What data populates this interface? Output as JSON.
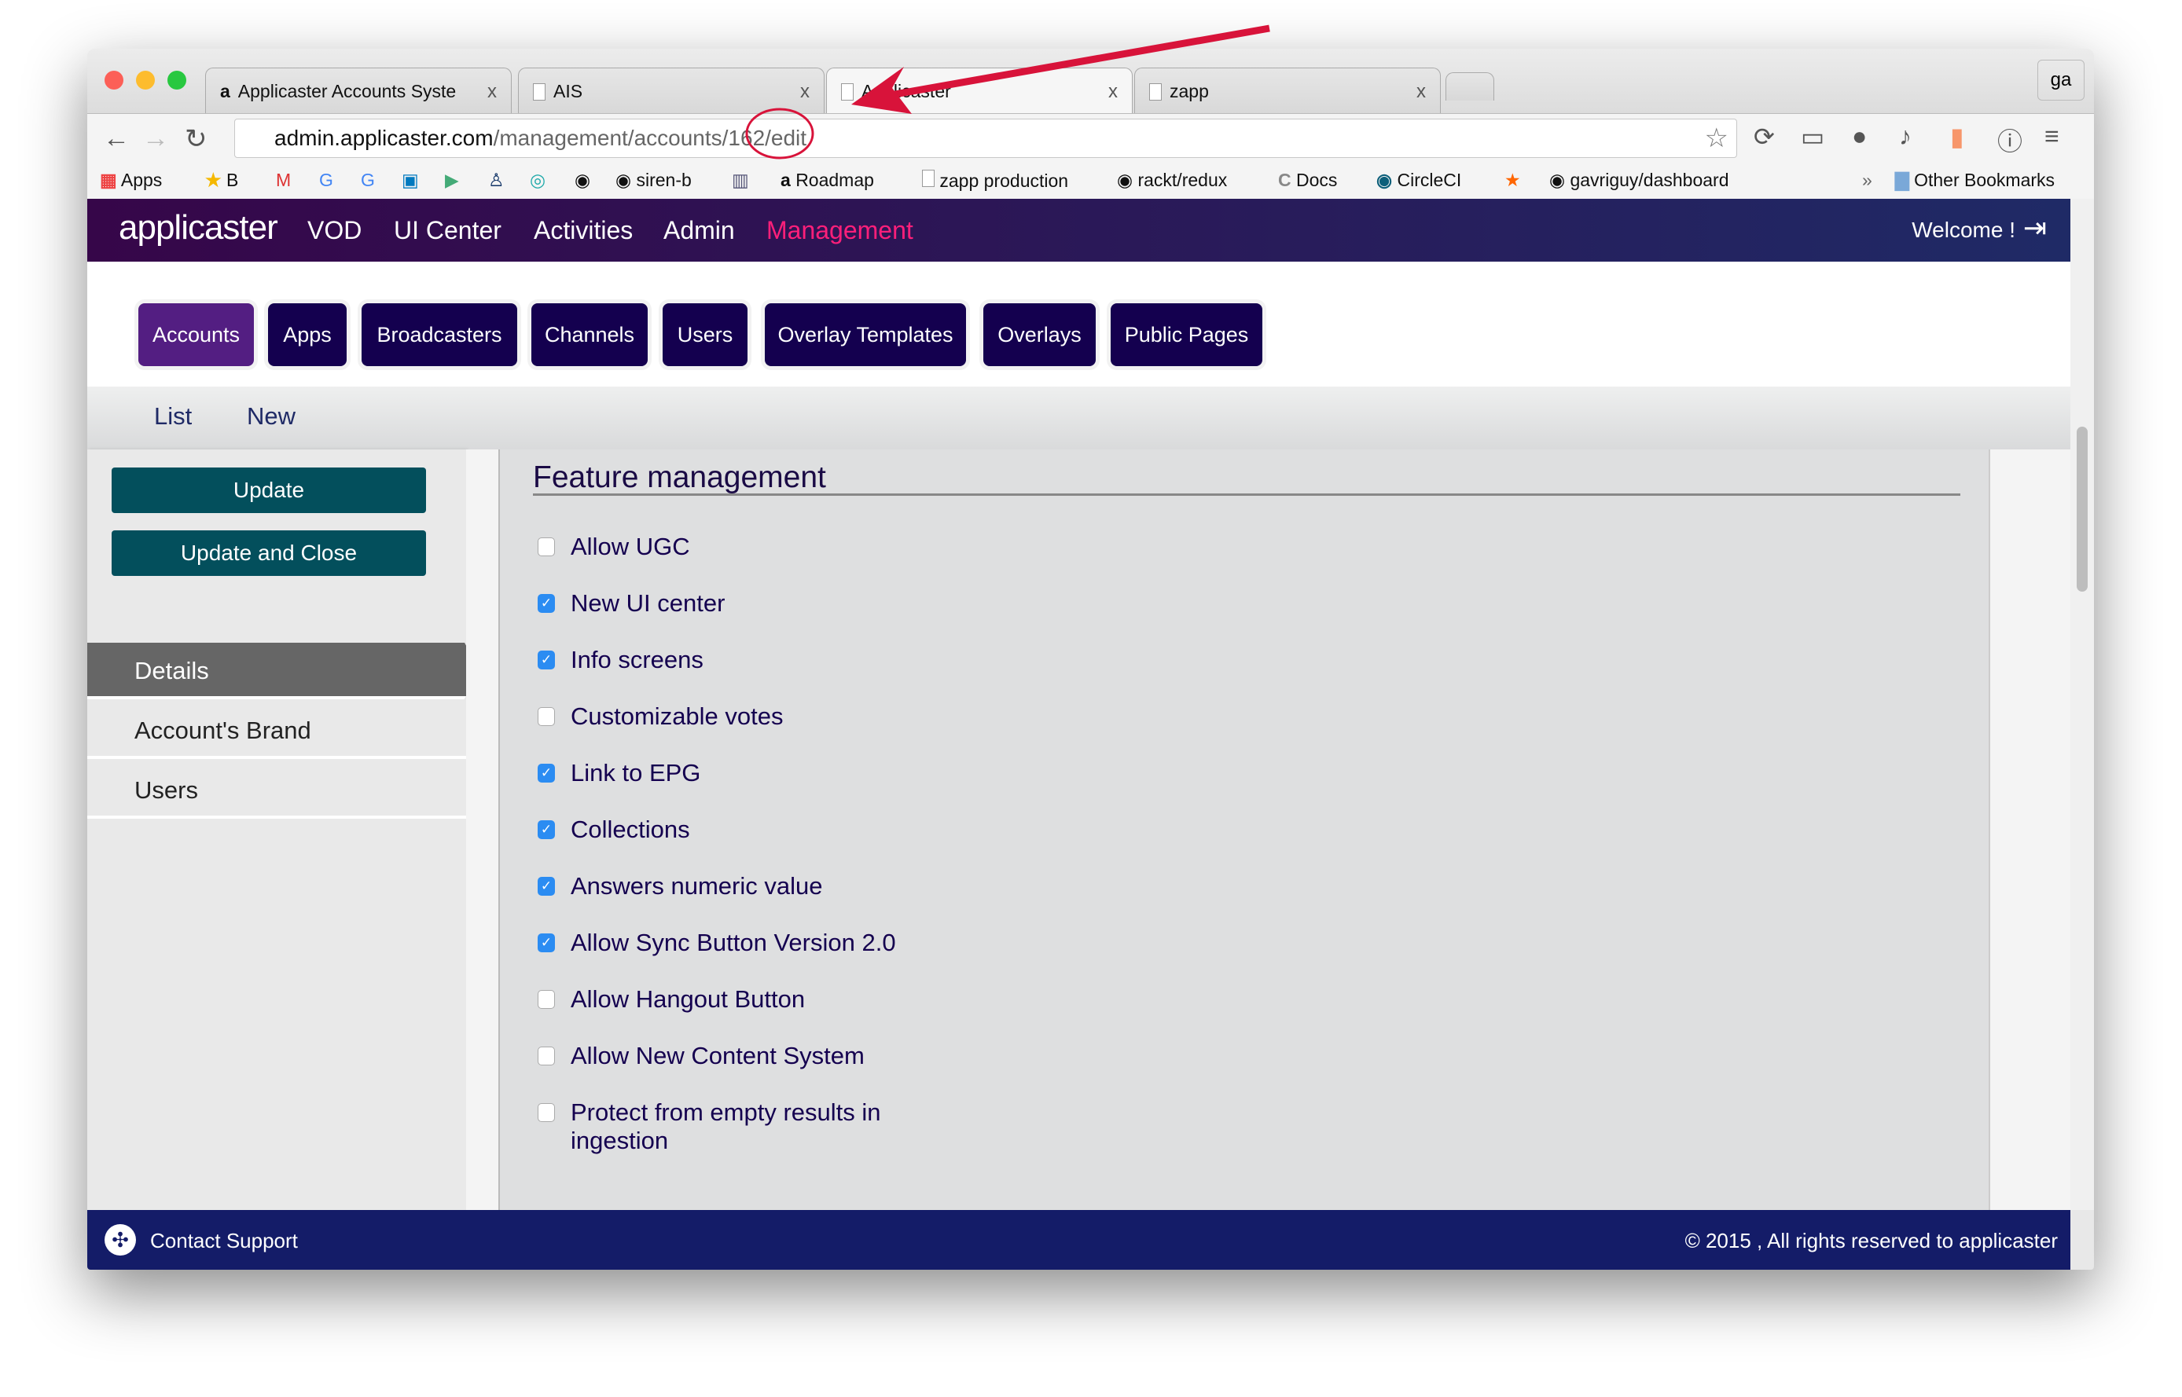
{
  "browser": {
    "tabs": [
      {
        "title": "Applicaster Accounts Syste",
        "icon": "applicaster-favicon"
      },
      {
        "title": "AIS",
        "icon": "page-icon"
      },
      {
        "title": "Applicaster",
        "icon": "page-icon"
      },
      {
        "title": "zapp",
        "icon": "page-icon"
      }
    ],
    "close_glyph": "x",
    "profile": "ga",
    "url_host": "admin.applicaster.com",
    "url_path": "/management/accounts/162/edit",
    "bookmarks": [
      "Apps",
      "B",
      "siren-b",
      "Roadmap",
      "zapp production",
      "rackt/redux",
      "Docs",
      "CircleCI",
      "gavriguy/dashboard"
    ],
    "bookmarks_overflow": "»",
    "other_bookmarks": "Other Bookmarks"
  },
  "header": {
    "logo": "applicaster",
    "nav": [
      "VOD",
      "UI Center",
      "Activities",
      "Admin",
      "Management"
    ],
    "active": "Management",
    "welcome": "Welcome !"
  },
  "subnav": {
    "items": [
      "Accounts",
      "Apps",
      "Broadcasters",
      "Channels",
      "Users",
      "Overlay Templates",
      "Overlays",
      "Public Pages"
    ],
    "active": "Accounts"
  },
  "actions": {
    "list": "List",
    "new": "New"
  },
  "sidebar": {
    "update": "Update",
    "update_close": "Update and Close",
    "items": [
      "Details",
      "Account's Brand",
      "Users"
    ],
    "active": "Details"
  },
  "main": {
    "title": "Feature management",
    "features": [
      {
        "label": "Allow UGC",
        "checked": false
      },
      {
        "label": "New UI center",
        "checked": true
      },
      {
        "label": "Info screens",
        "checked": true
      },
      {
        "label": "Customizable votes",
        "checked": false
      },
      {
        "label": "Link to EPG",
        "checked": true
      },
      {
        "label": "Collections",
        "checked": true
      },
      {
        "label": "Answers numeric value",
        "checked": true
      },
      {
        "label": "Allow Sync Button Version 2.0",
        "checked": true
      },
      {
        "label": "Allow Hangout Button",
        "checked": false
      },
      {
        "label": "Allow New Content System",
        "checked": false
      },
      {
        "label": "Protect from empty results in ingestion",
        "checked": false
      }
    ]
  },
  "footer": {
    "contact": "Contact Support",
    "copyright": "© 2015 , All rights reserved to applicaster"
  },
  "colors": {
    "annotation": "#d8133a",
    "accent": "#ff1f7a",
    "nav_button": "#14004f",
    "active_button": "#531e82",
    "update_button": "#034f5c",
    "footer": "#141c68",
    "checkbox": "#2b8cf2"
  }
}
